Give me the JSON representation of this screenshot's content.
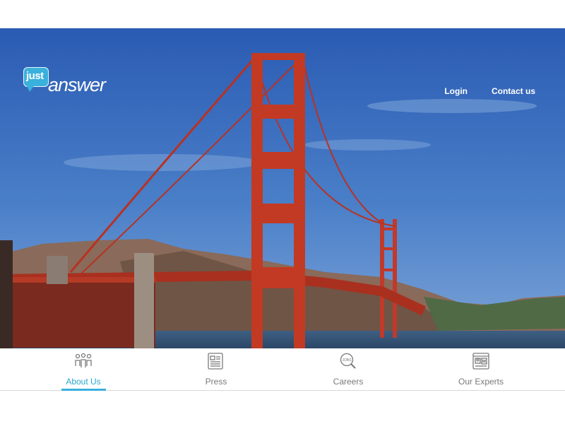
{
  "brand": {
    "logo_top": "just",
    "logo_main": "answer",
    "accent_color": "#3ab0dc"
  },
  "header": {
    "nav": [
      {
        "label": "Login"
      },
      {
        "label": "Contact us"
      }
    ]
  },
  "hero": {
    "image_subject": "golden-gate-bridge"
  },
  "tabs": [
    {
      "label": "About Us",
      "icon": "people-icon",
      "active": true
    },
    {
      "label": "Press",
      "icon": "newspaper-icon",
      "active": false
    },
    {
      "label": "Careers",
      "icon": "jobs-search-icon",
      "active": false
    },
    {
      "label": "Our Experts",
      "icon": "expert-profile-icon",
      "active": false
    }
  ]
}
